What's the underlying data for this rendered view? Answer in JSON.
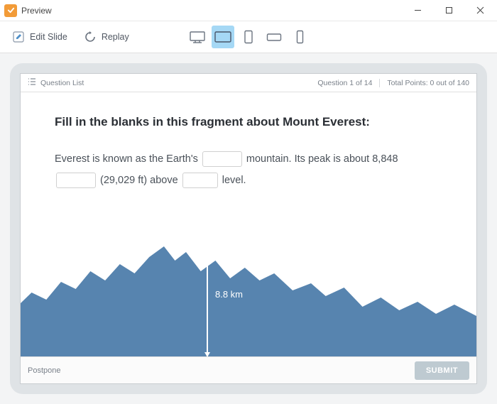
{
  "window": {
    "title": "Preview"
  },
  "toolbar": {
    "edit_slide": "Edit Slide",
    "replay": "Replay"
  },
  "slide_header": {
    "question_list": "Question List",
    "progress": "Question 1 of 14",
    "points": "Total Points: 0 out of 140"
  },
  "question": "Fill in the blanks in this fragment about Mount Everest:",
  "paragraph": {
    "t1": "Everest is known as the Earth's ",
    "t2": " mountain. Its peak is about 8,848 ",
    "t3": " (29,029 ft) above ",
    "t4": " level."
  },
  "annotation_label": "8.8 km",
  "footer": {
    "postpone": "Postpone",
    "submit": "SUBMIT"
  }
}
